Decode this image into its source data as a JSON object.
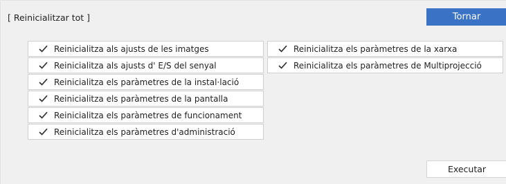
{
  "dialog": {
    "title": "[ Reinicialitzar tot ]",
    "back_label": "Tornar",
    "execute_label": "Executar"
  },
  "options_left": [
    {
      "label": "Reinicialitza als ajusts de les imatges",
      "checked": true
    },
    {
      "label": "Reinicialitza als ajusts d' E/S del senyal",
      "checked": true
    },
    {
      "label": "Reinicialitza els paràmetres de la instal·lació",
      "checked": true
    },
    {
      "label": "Reinicialitza els paràmetres de la pantalla",
      "checked": true
    },
    {
      "label": "Reinicialitza els paràmetres de funcionament",
      "checked": true
    },
    {
      "label": "Reinicialitza els paràmetres d'administració",
      "checked": true
    }
  ],
  "options_right": [
    {
      "label": "Reinicialitza els paràmetres de la xarxa",
      "checked": true
    },
    {
      "label": "Reinicialitza els paràmetres de Multiprojecció",
      "checked": true
    }
  ],
  "icons": {
    "check": "check-icon"
  },
  "colors": {
    "accent": "#3a72c5",
    "panel_bg": "#f0f0f0",
    "item_bg": "#ffffff"
  }
}
